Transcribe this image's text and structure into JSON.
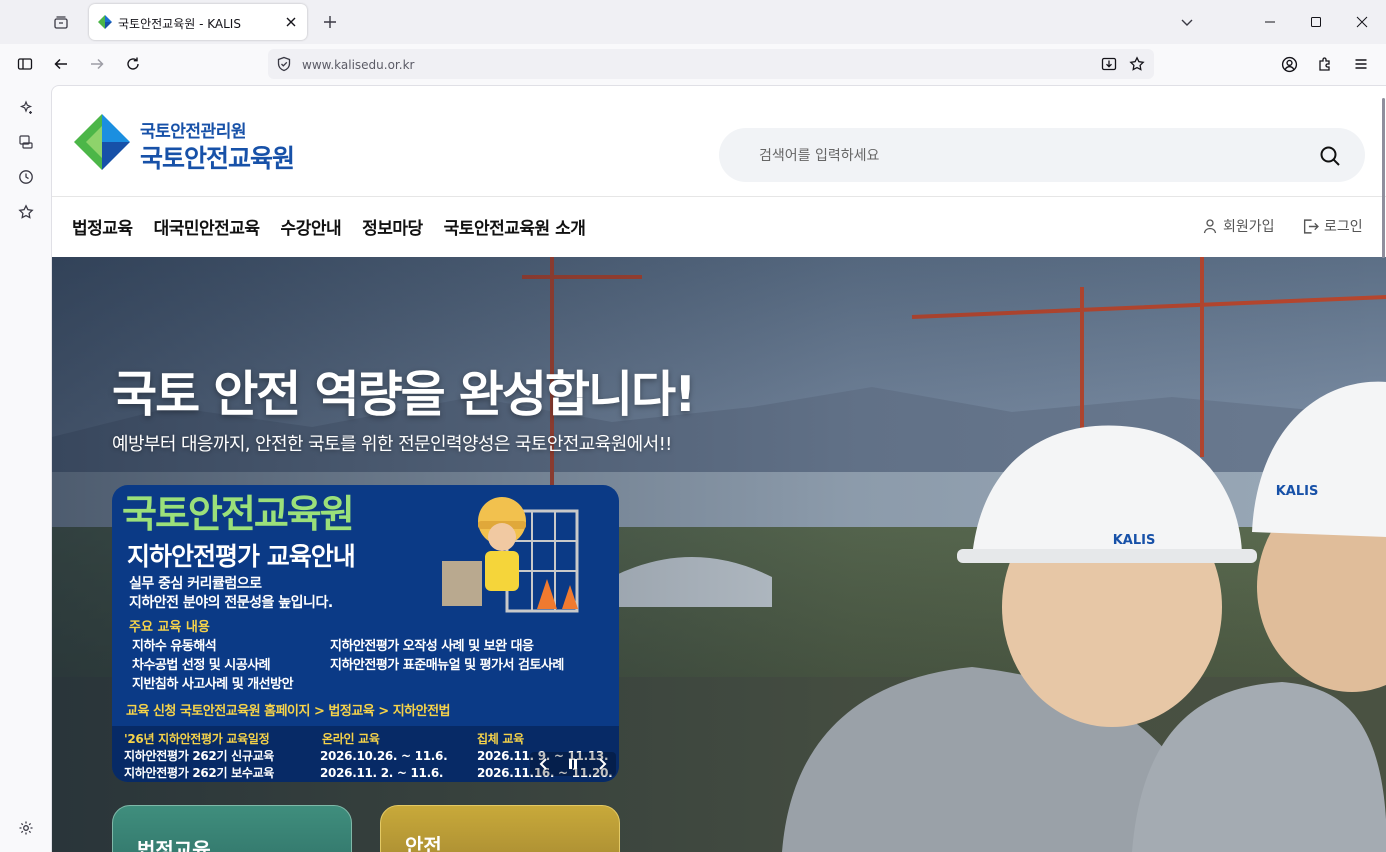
{
  "browser": {
    "tab_title": "국토안전교육원 - KALIS",
    "url": "www.kalisedu.or.kr",
    "icons": [
      "tab-group-icon",
      "close-icon",
      "new-tab-icon",
      "tab-list-icon",
      "minimize-icon",
      "maximize-icon",
      "sidebar-toggle-icon",
      "back-icon",
      "forward-icon",
      "reload-icon",
      "shield-icon",
      "download-icon",
      "bookmark-star-icon",
      "account-icon",
      "extensions-icon",
      "menu-icon"
    ]
  },
  "sidebar_icons": [
    "ai-sparkle-icon",
    "synced-tabs-icon",
    "history-icon",
    "bookmarks-icon",
    "settings-icon"
  ],
  "site": {
    "logo_line1": "국토안전관리원",
    "logo_line2": "국토안전교육원",
    "search_placeholder": "검색어를 입력하세요",
    "nav": [
      "법정교육",
      "대국민안전교육",
      "수강안내",
      "정보마당",
      "국토안전교육원 소개"
    ],
    "signup": "회원가입",
    "login": "로그인"
  },
  "hero": {
    "title": "국토 안전 역량을 완성합니다!",
    "subtitle": "예방부터 대응까지, 안전한 국토를 위한 전문인력양성은 국토안전교육원에서!!",
    "helmet_logo": "KALIS"
  },
  "banner": {
    "org": "국토안전교육원",
    "heading": "지하안전평가 교육안내",
    "desc_line1": "실무 중심 커리큘럼으로",
    "desc_line2": "지하안전 분야의 전문성을 높입니다.",
    "key_label": "주요 교육 내용",
    "items_left": [
      "지하수 유동해석",
      "차수공법 선정 및 시공사례",
      "지반침하 사고사례 및 개선방안"
    ],
    "items_right": [
      "지하안전평가 오작성 사례 및 보완 대응",
      "지하안전평가 표준매뉴얼 및 평가서 검토사례"
    ],
    "apply": "교육 신청  국토안전교육원 홈페이지 > 법정교육 > 지하안전법",
    "schedule": {
      "header": [
        "'26년 지하안전평가 교육일정",
        "온라인 교육",
        "집체 교육"
      ],
      "row1": [
        "지하안전평가 262기 신규교육",
        "2026.10.26. ~ 11.6.",
        "2026.11. 9. ~ 11.13."
      ],
      "row2": [
        "지하안전평가 262기 보수교육",
        "2026.11. 2. ~ 11.6.",
        "2026.11.16. ~ 11.20."
      ]
    }
  },
  "cards": [
    "법정교육",
    "안전"
  ],
  "colors": {
    "brand_blue": "#1751a8",
    "brand_green": "#4cb648",
    "banner_navy": "#0b3a86",
    "accent_yellow": "#f6d34a"
  }
}
